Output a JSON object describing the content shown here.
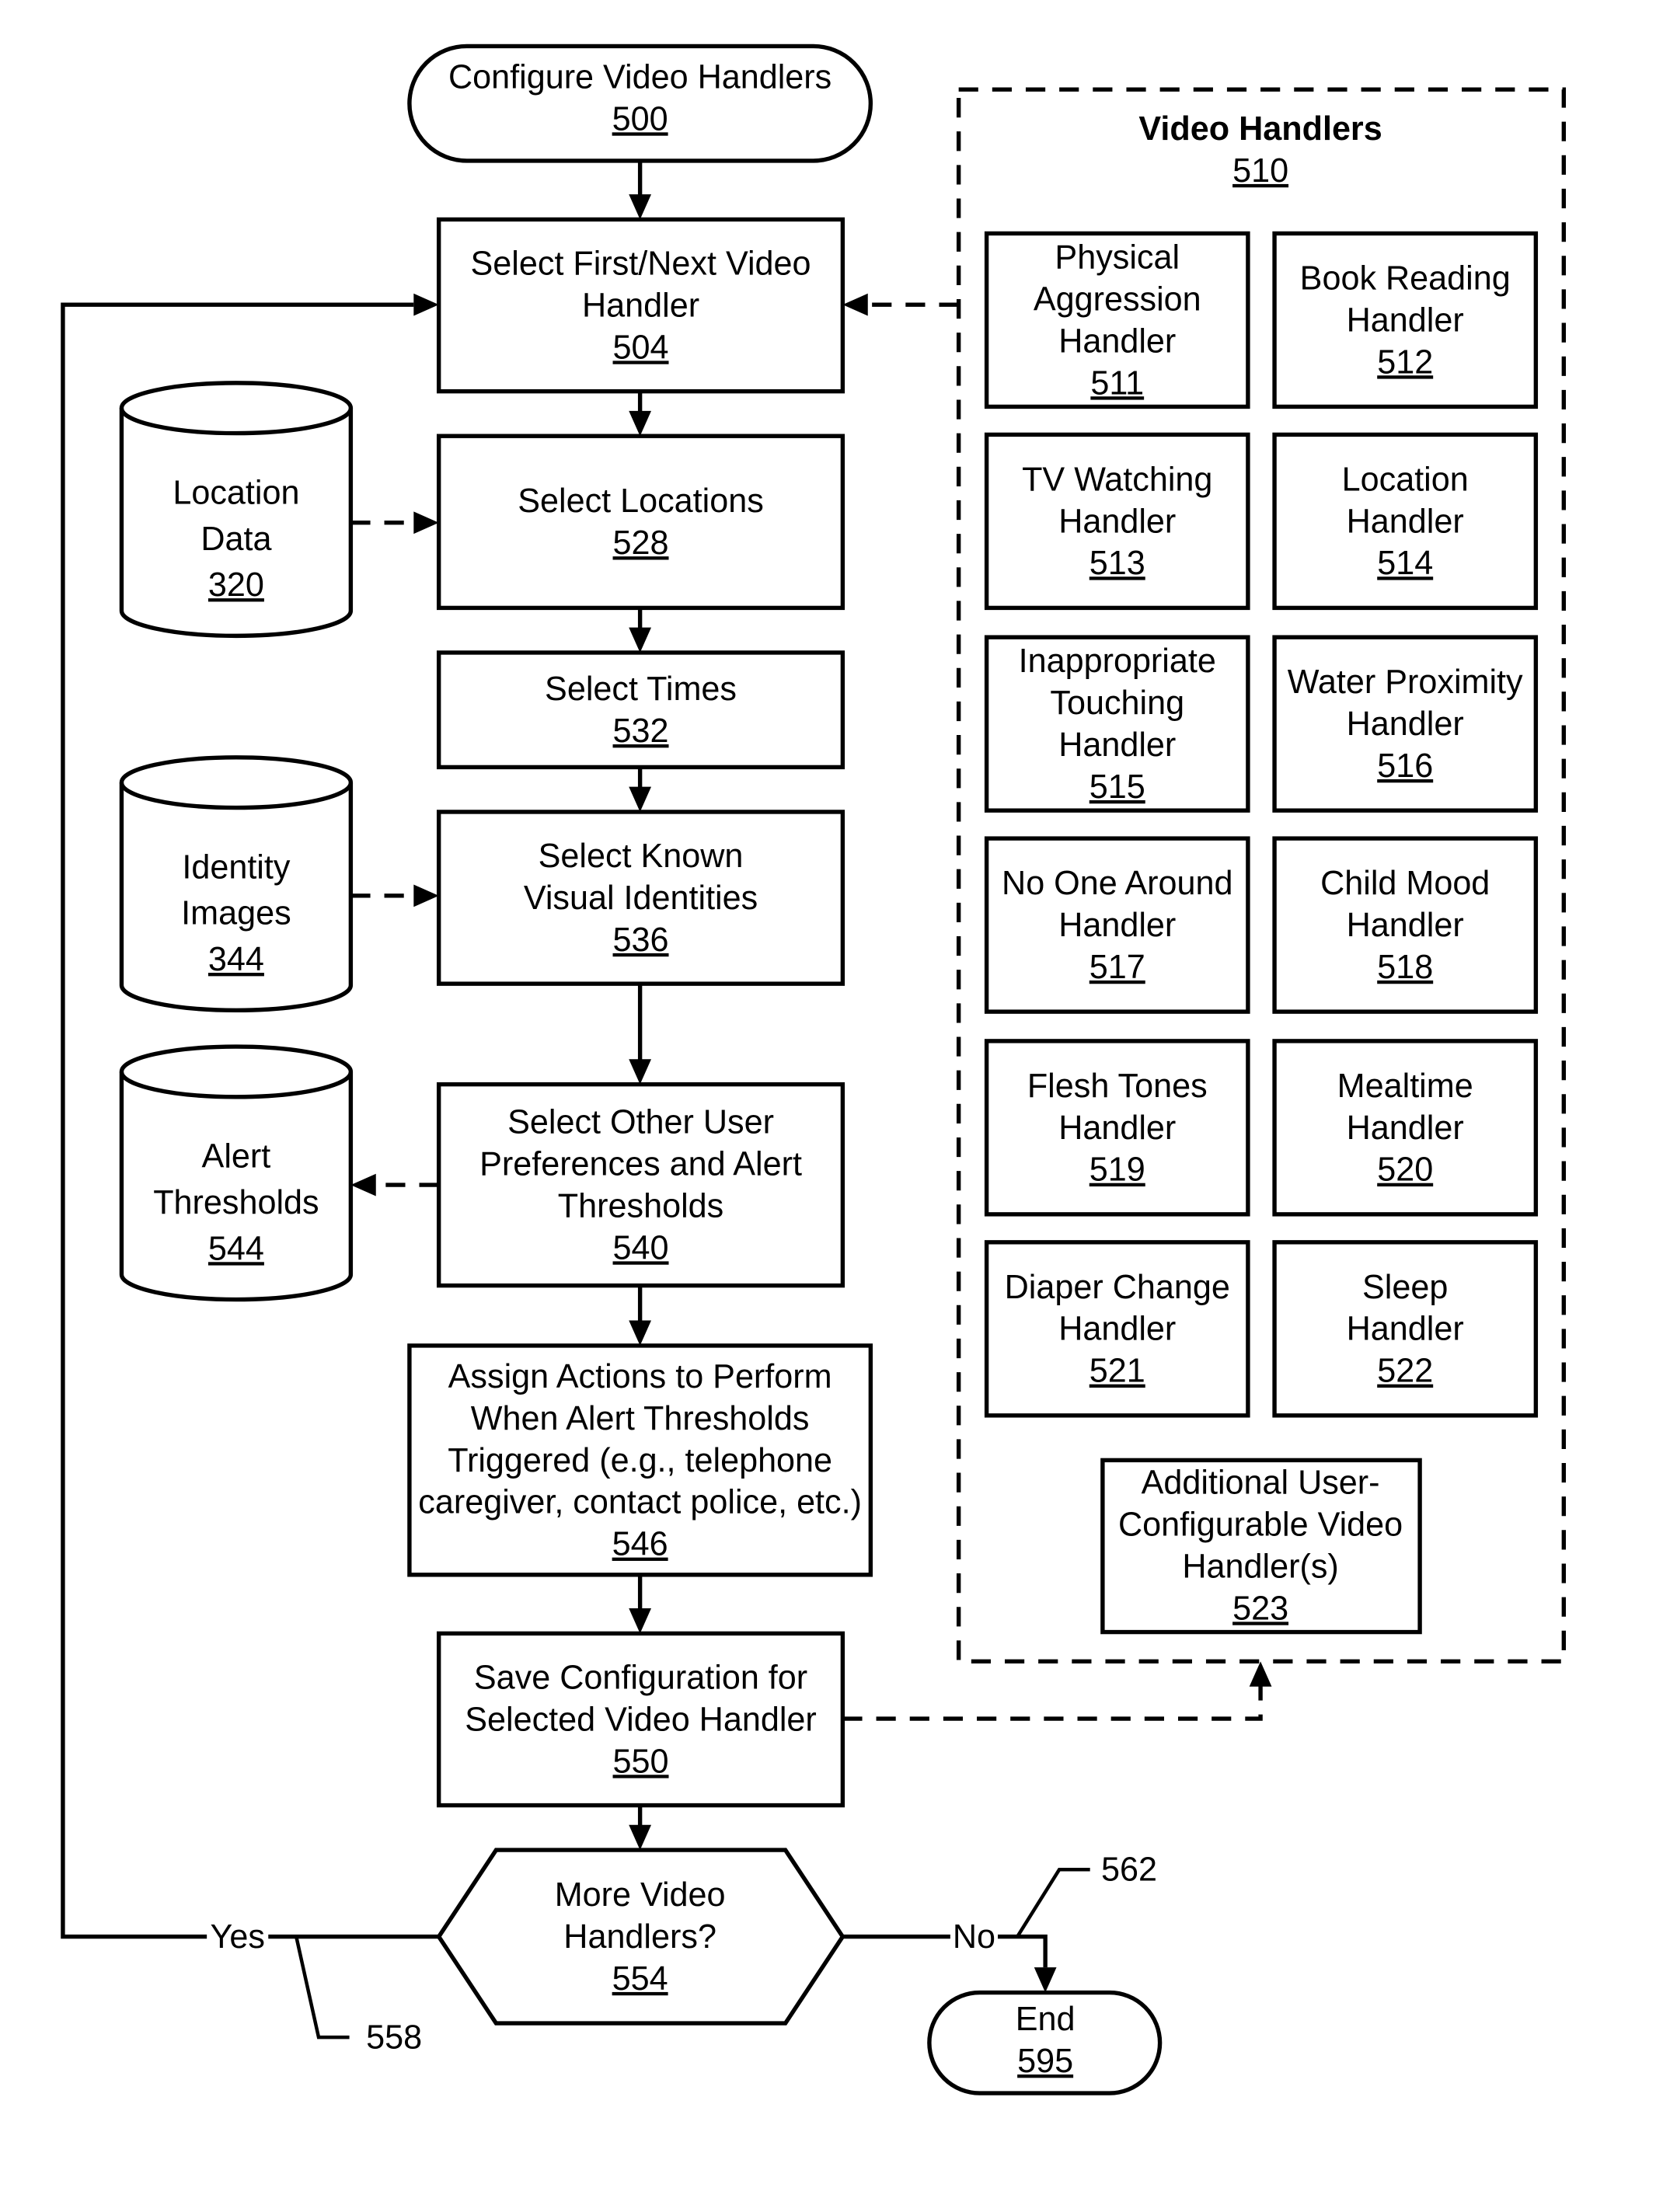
{
  "start": {
    "label": [
      "Configure Video Handlers"
    ],
    "ref": "500"
  },
  "steps": [
    {
      "id": "select-handler",
      "label": [
        "Select First/Next Video",
        "Handler"
      ],
      "ref": "504"
    },
    {
      "id": "select-locations",
      "label": [
        "Select Locations"
      ],
      "ref": "528"
    },
    {
      "id": "select-times",
      "label": [
        "Select Times"
      ],
      "ref": "532"
    },
    {
      "id": "select-identities",
      "label": [
        "Select Known",
        "Visual Identities"
      ],
      "ref": "536"
    },
    {
      "id": "select-preferences",
      "label": [
        "Select Other User",
        "Preferences and Alert",
        "Thresholds"
      ],
      "ref": "540"
    },
    {
      "id": "assign-actions",
      "label": [
        "Assign Actions to Perform",
        "When Alert Thresholds",
        "Triggered (e.g., telephone",
        "caregiver, contact police, etc.)"
      ],
      "ref": "546"
    },
    {
      "id": "save-config",
      "label": [
        "Save Configuration for",
        "Selected Video Handler"
      ],
      "ref": "550"
    }
  ],
  "decision": {
    "label": [
      "More Video",
      "Handlers?"
    ],
    "ref": "554",
    "yes_label": "Yes",
    "no_label": "No"
  },
  "end": {
    "label": [
      "End"
    ],
    "ref": "595"
  },
  "databases": [
    {
      "id": "location-data",
      "label": [
        "Location",
        "Data"
      ],
      "ref": "320"
    },
    {
      "id": "identity-images",
      "label": [
        "Identity",
        "Images"
      ],
      "ref": "344"
    },
    {
      "id": "alert-thresholds",
      "label": [
        "Alert",
        "Thresholds"
      ],
      "ref": "544"
    }
  ],
  "handlers_group": {
    "title": "Video Handlers",
    "ref": "510",
    "handlers": [
      {
        "label": [
          "Physical",
          "Aggression",
          "Handler"
        ],
        "ref": "511"
      },
      {
        "label": [
          "Book Reading",
          "Handler"
        ],
        "ref": "512"
      },
      {
        "label": [
          "TV Watching",
          "Handler"
        ],
        "ref": "513"
      },
      {
        "label": [
          "Location",
          "Handler"
        ],
        "ref": "514"
      },
      {
        "label": [
          "Inappropriate",
          "Touching",
          "Handler"
        ],
        "ref": "515"
      },
      {
        "label": [
          "Water Proximity",
          "Handler"
        ],
        "ref": "516"
      },
      {
        "label": [
          "No One Around",
          "Handler"
        ],
        "ref": "517"
      },
      {
        "label": [
          "Child Mood",
          "Handler"
        ],
        "ref": "518"
      },
      {
        "label": [
          "Flesh Tones",
          "Handler"
        ],
        "ref": "519"
      },
      {
        "label": [
          "Mealtime",
          "Handler"
        ],
        "ref": "520"
      },
      {
        "label": [
          "Diaper Change",
          "Handler"
        ],
        "ref": "521"
      },
      {
        "label": [
          "Sleep",
          "Handler"
        ],
        "ref": "522"
      }
    ],
    "additional": {
      "label": [
        "Additional User-",
        "Configurable Video",
        "Handler(s)"
      ],
      "ref": "523"
    }
  },
  "callouts": {
    "yes_ref": "558",
    "no_ref": "562"
  }
}
